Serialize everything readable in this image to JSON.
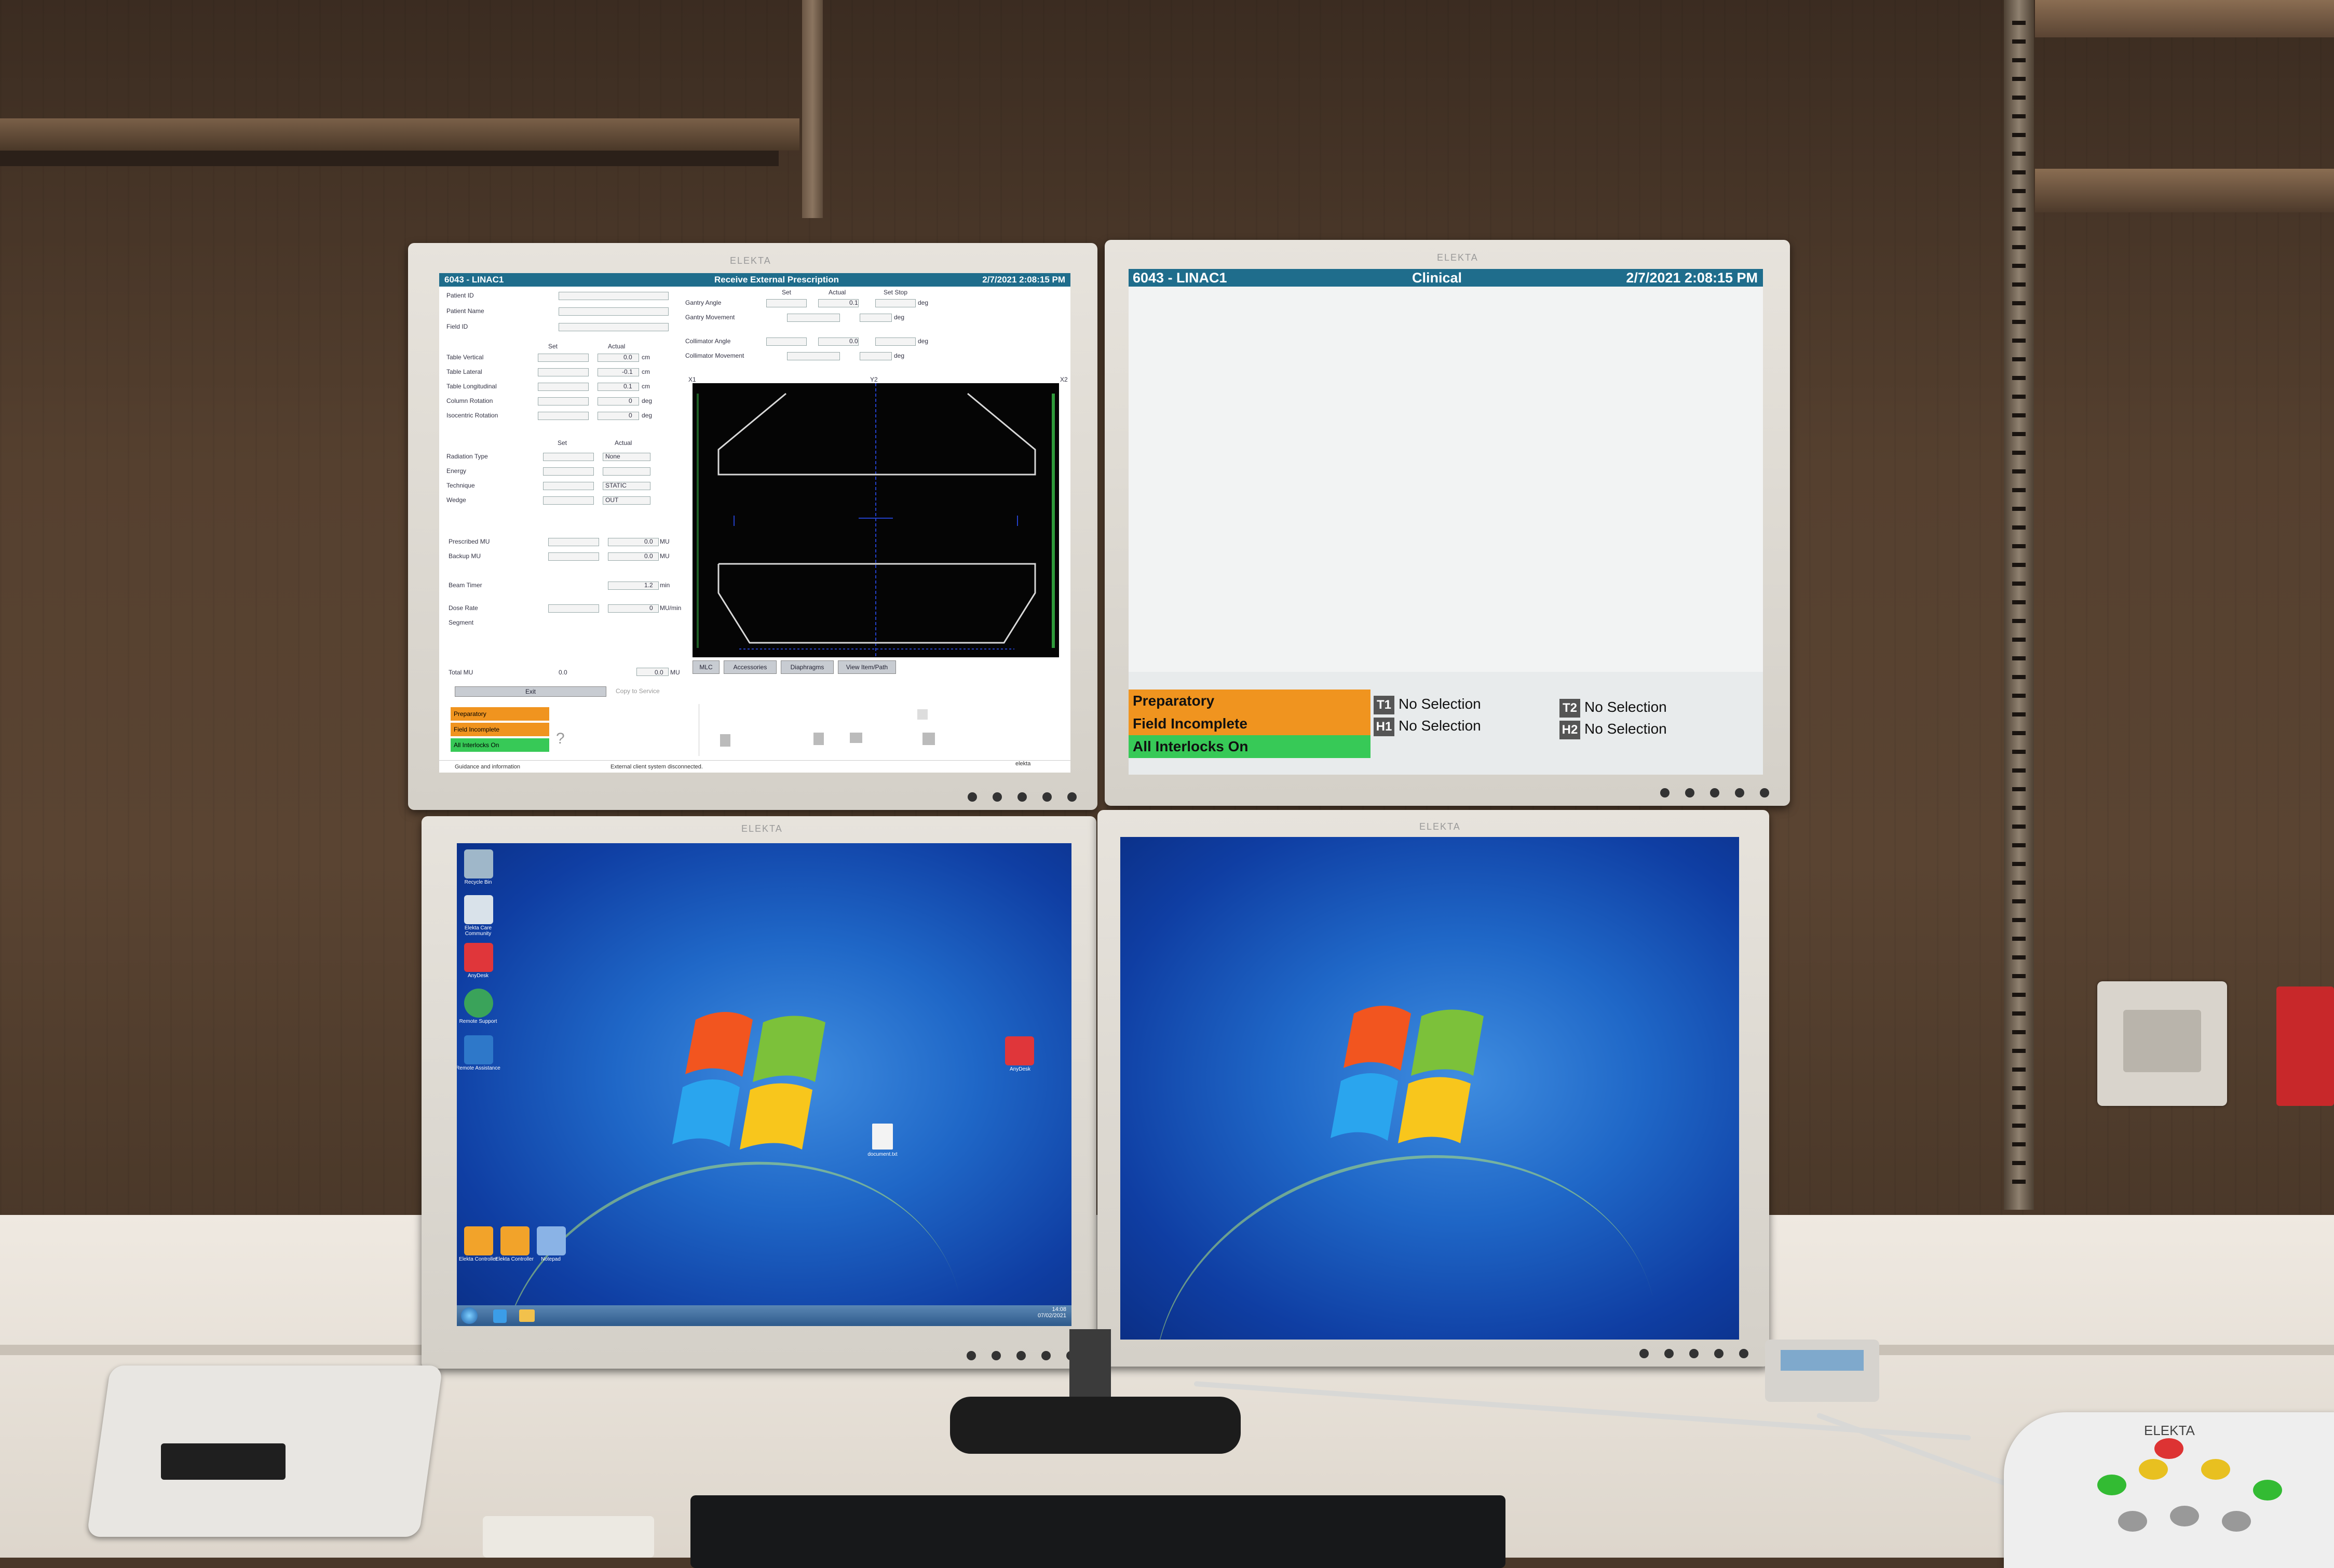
{
  "monitor_brand": "ELEKTA",
  "console": {
    "station": "6043 - LINAC1",
    "window_title": "Receive External Prescription",
    "datetime": "2/7/2021 2:08:15 PM",
    "patient_fields": [
      "Patient ID",
      "Patient Name",
      "Field ID"
    ],
    "table_header": {
      "set": "Set",
      "actual": "Actual"
    },
    "table_rows": [
      {
        "label": "Table Vertical",
        "actual": "0.0",
        "unit": "cm"
      },
      {
        "label": "Table Lateral",
        "actual": "-0.1",
        "unit": "cm"
      },
      {
        "label": "Table Longitudinal",
        "actual": "0.1",
        "unit": "cm"
      },
      {
        "label": "Column Rotation",
        "actual": "0",
        "unit": "deg"
      },
      {
        "label": "Isocentric Rotation",
        "actual": "0",
        "unit": "deg"
      }
    ],
    "gantry_header": {
      "set": "Set",
      "actual": "Actual",
      "stop": "Set Stop"
    },
    "gantry_rows": [
      {
        "label": "Gantry Angle",
        "actual": "0.1",
        "unit": "deg"
      },
      {
        "label": "Gantry Movement",
        "actual": "",
        "unit": "deg"
      },
      {
        "label": "Collimator Angle",
        "actual": "0.0",
        "unit": "deg"
      },
      {
        "label": "Collimator Movement",
        "actual": "",
        "unit": "deg"
      }
    ],
    "beam_rows": [
      {
        "label": "Radiation Type",
        "actual": "None"
      },
      {
        "label": "Energy",
        "actual": ""
      },
      {
        "label": "Technique",
        "actual": "STATIC"
      },
      {
        "label": "Wedge",
        "actual": "OUT"
      }
    ],
    "mu_rows": [
      {
        "label": "Prescribed MU",
        "actual": "0.0",
        "unit": "MU"
      },
      {
        "label": "Backup MU",
        "actual": "0.0",
        "unit": "MU"
      },
      {
        "label": "Beam Timer",
        "actual": "1.2",
        "unit": "min"
      },
      {
        "label": "Dose Rate",
        "actual": "0",
        "unit": "MU/min"
      },
      {
        "label": "Segment",
        "actual": "",
        "unit": ""
      }
    ],
    "total_mu": {
      "label": "Total MU",
      "value": "0.0",
      "actual": "0.0",
      "unit": "MU"
    },
    "bev_labels": {
      "left": "X1",
      "center": "Y2",
      "right": "X2"
    },
    "tabs": [
      "MLC",
      "Accessories",
      "Diaphragms",
      "View Item/Path"
    ],
    "exit_label": "Exit",
    "copy_label": "Copy to Service",
    "status": [
      {
        "text": "Preparatory",
        "color": "#f0941f"
      },
      {
        "text": "Field Incomplete",
        "color": "#f0941f"
      },
      {
        "text": "All Interlocks On",
        "color": "#37c957"
      }
    ],
    "footer_left": "Guidance and information",
    "footer_msg": "External client system disconnected.",
    "footer_right": "elekta"
  },
  "clinical": {
    "station": "6043 - LINAC1",
    "title": "Clinical",
    "datetime": "2/7/2021 2:08:15 PM",
    "status": [
      {
        "text": "Preparatory",
        "color": "#f0941f"
      },
      {
        "text": "Field Incomplete",
        "color": "#f0941f"
      },
      {
        "text": "All Interlocks On",
        "color": "#37c957"
      }
    ],
    "selections": [
      {
        "tag": "T1",
        "text": "No Selection"
      },
      {
        "tag": "T2",
        "text": "No Selection"
      },
      {
        "tag": "H1",
        "text": "No Selection"
      },
      {
        "tag": "H2",
        "text": "No Selection"
      }
    ]
  },
  "desktop_left": {
    "icons": [
      {
        "label": "Recycle Bin",
        "color": "#9fb7c9"
      },
      {
        "label": "Elekta Care Community",
        "color": "#d9e2ea"
      },
      {
        "label": "AnyDesk",
        "color": "#e0363a"
      },
      {
        "label": "Remote Support",
        "color": "#3aa35a"
      },
      {
        "label": "Remote Assistance",
        "color": "#2e78c9"
      },
      {
        "label": "Elekta Controller",
        "color": "#f2a32a"
      },
      {
        "label": "Elekta Controller",
        "color": "#f2a32a"
      },
      {
        "label": "Notepad",
        "color": "#8ab3e6"
      }
    ],
    "anydesk_label": "AnyDesk",
    "file_label": "document.txt",
    "clock": {
      "time": "14:08",
      "date": "07/02/2021"
    }
  }
}
